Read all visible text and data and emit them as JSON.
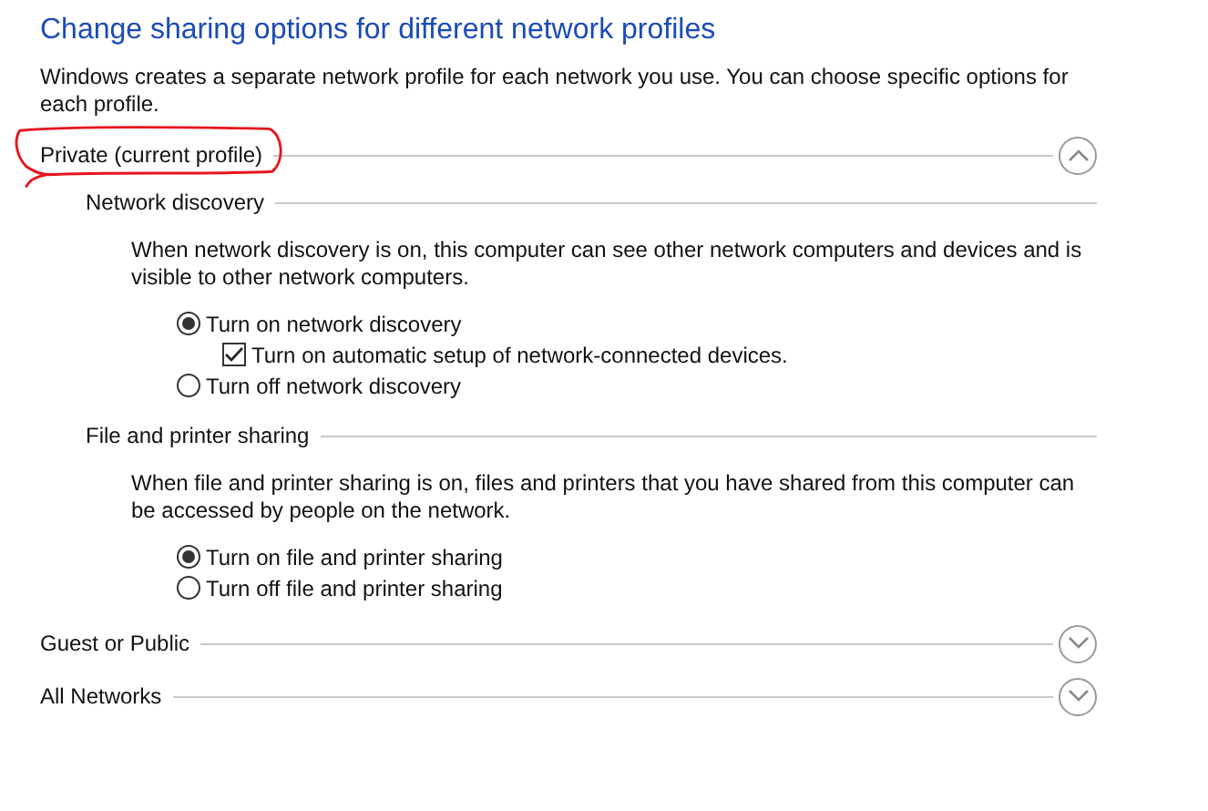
{
  "title": "Change sharing options for different network profiles",
  "description": "Windows creates a separate network profile for each network you use. You can choose specific options for each profile.",
  "profiles": [
    {
      "name": "Private (current profile)",
      "expanded": true,
      "highlighted": true,
      "sections": [
        {
          "heading": "Network discovery",
          "description": "When network discovery is on, this computer can see other network computers and devices and is visible to other network computers.",
          "options": [
            {
              "kind": "radio",
              "label": "Turn on network discovery",
              "selected": true,
              "children": [
                {
                  "kind": "checkbox",
                  "label": "Turn on automatic setup of network-connected devices.",
                  "checked": true
                }
              ]
            },
            {
              "kind": "radio",
              "label": "Turn off network discovery",
              "selected": false
            }
          ]
        },
        {
          "heading": "File and printer sharing",
          "description": "When file and printer sharing is on, files and printers that you have shared from this computer can be accessed by people on the network.",
          "options": [
            {
              "kind": "radio",
              "label": "Turn on file and printer sharing",
              "selected": true
            },
            {
              "kind": "radio",
              "label": "Turn off file and printer sharing",
              "selected": false
            }
          ]
        }
      ]
    },
    {
      "name": "Guest or Public",
      "expanded": false,
      "highlighted": false
    },
    {
      "name": "All Networks",
      "expanded": false,
      "highlighted": false
    }
  ]
}
